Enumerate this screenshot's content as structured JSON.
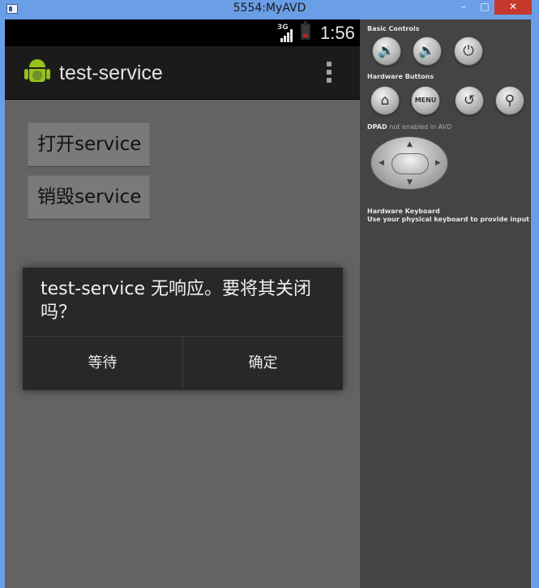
{
  "window": {
    "title": "5554:MyAVD",
    "minimize": "–",
    "maximize": "□",
    "close": "✕"
  },
  "statusbar": {
    "network": "3G",
    "time": "1:56"
  },
  "actionbar": {
    "app_title": "test-service",
    "overflow_icon": "overflow-menu-icon"
  },
  "content": {
    "open_service_button": "打开service",
    "destroy_service_button": "销毁service"
  },
  "dialog": {
    "message": "test-service 无响应。要将其关闭吗？",
    "wait_button": "等待",
    "ok_button": "确定"
  },
  "panel": {
    "basic_controls_label": "Basic Controls",
    "hardware_buttons_label": "Hardware Buttons",
    "dpad_label": "DPAD",
    "dpad_note": "not enabled in AVD",
    "keyboard_label": "Hardware Keyboard",
    "keyboard_hint": "Use your physical keyboard to provide input",
    "menu_button": "MENU"
  },
  "colors": {
    "screen_bg": "#636363",
    "actionbar_bg": "#1b1b1b",
    "dialog_bg": "#282828",
    "panel_bg": "#444444",
    "frame": "#6a9ee6",
    "close_red": "#c7382c",
    "android_green": "#94c11f"
  }
}
